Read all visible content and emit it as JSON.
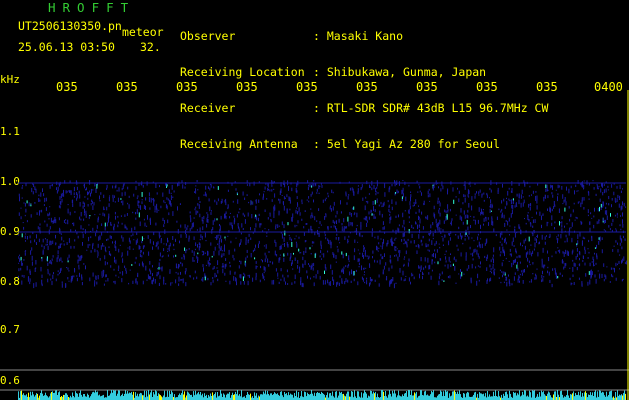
{
  "title": "HROFFT",
  "file_name": "UT2506130350.pn",
  "mode": "meteor",
  "date_time": "25.06.13 03:50",
  "count": "32.",
  "header": {
    "labels": [
      "Observer",
      "Receiving Location",
      "Receiver",
      "Receiving Antenna"
    ],
    "values": [
      ": Masaki Kano",
      ": Shibukawa, Gunma, Japan",
      ": RTL-SDR SDR# 43dB L15 96.7MHz CW",
      ": 5el Yagi Az 280 for Seoul"
    ]
  },
  "axis": {
    "unit": "kHz",
    "time_ticks": [
      "035",
      "035",
      "035",
      "035",
      "035",
      "035",
      "035",
      "035",
      "035",
      "0400"
    ],
    "khz_ticks": [
      "1.1",
      "1.0",
      "0.9",
      "0.8",
      "0.7",
      "0.6"
    ]
  },
  "colors": {
    "background": "#000000",
    "text": "#ffff00",
    "title": "#33cc33",
    "signal_low": "#1a1aa0",
    "signal_high": "#33ffdd"
  }
}
